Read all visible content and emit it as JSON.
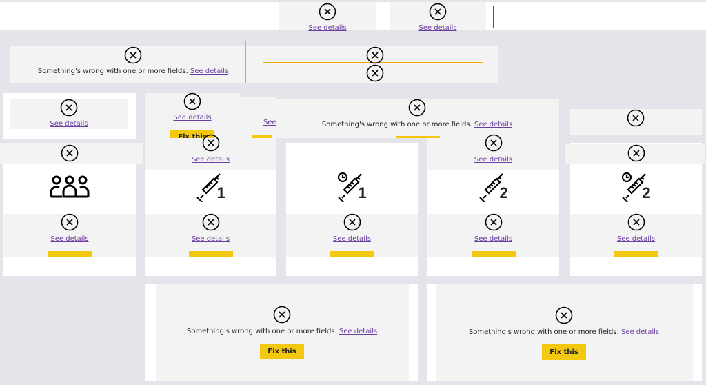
{
  "error": {
    "see_details": "See details",
    "message": "Something's wrong with one or more fields.",
    "fix_this": "Fix this"
  },
  "visuals": {
    "people": "people-group-icon",
    "dose1": {
      "icon": "syringe-icon",
      "label": "1"
    },
    "dose1_scheduled": {
      "icon": "syringe-clock-icon",
      "label": "1"
    },
    "dose2": {
      "icon": "syringe-icon",
      "label": "2"
    },
    "dose2_scheduled": {
      "icon": "syringe-clock-icon",
      "label": "2"
    }
  },
  "colors": {
    "background": "#e4e5ea",
    "error_panel": "#f3f3f3",
    "button": "#f2c811",
    "link": "#6b3fa0",
    "accent_line": "#f2a900"
  }
}
